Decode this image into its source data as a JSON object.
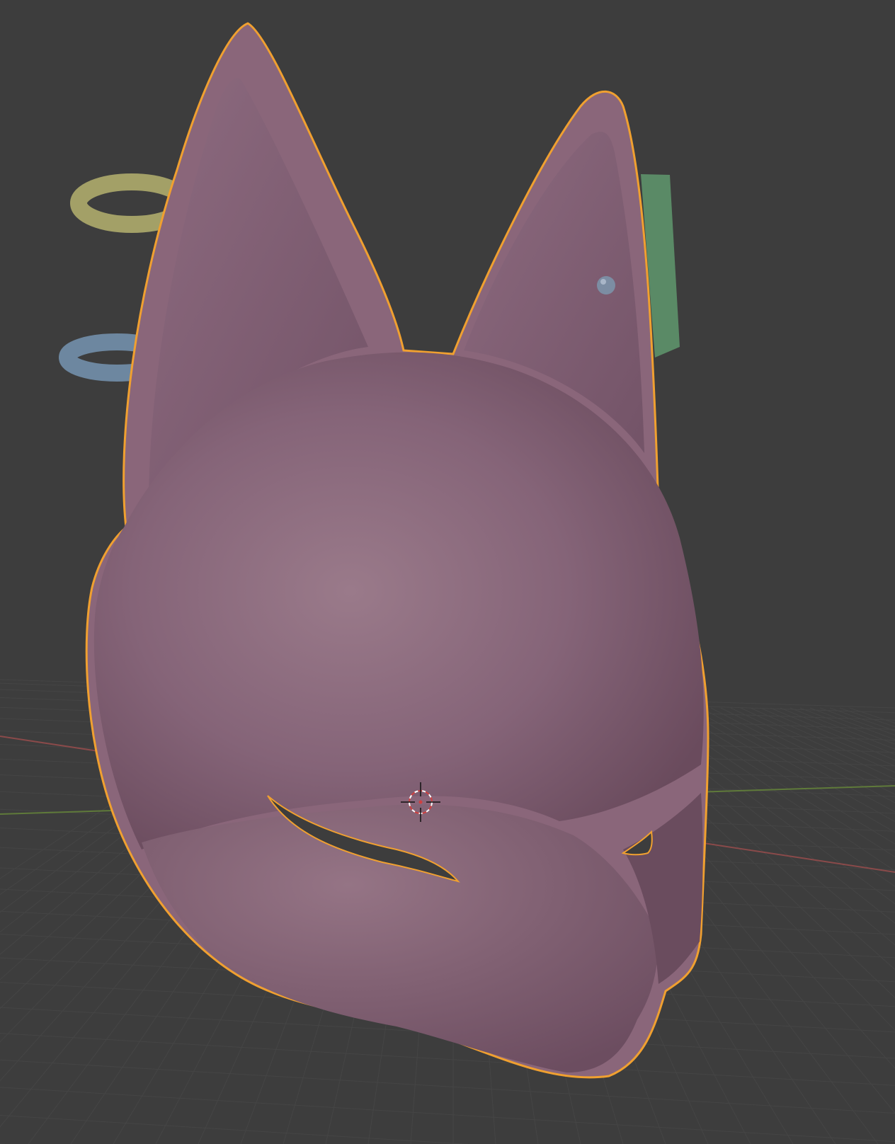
{
  "viewport": {
    "background_color": "#3d3d3d",
    "grid_color": "#454545",
    "x_axis_color": "#8a4a4a",
    "y_axis_color": "#5f7a3a"
  },
  "scene": {
    "selected_object": {
      "name": "fox-mask",
      "body_color": "#8a667a",
      "outline_color": "#f0a030"
    },
    "objects": [
      {
        "name": "ring-upper-left",
        "color": "#a3a067"
      },
      {
        "name": "ring-lower-left",
        "color": "#6d87a0"
      },
      {
        "name": "stud",
        "color": "#7c8da3"
      },
      {
        "name": "green-plane",
        "color": "#5a8a66"
      }
    ],
    "cursor_3d": {
      "icon": "3d-cursor-icon"
    }
  }
}
